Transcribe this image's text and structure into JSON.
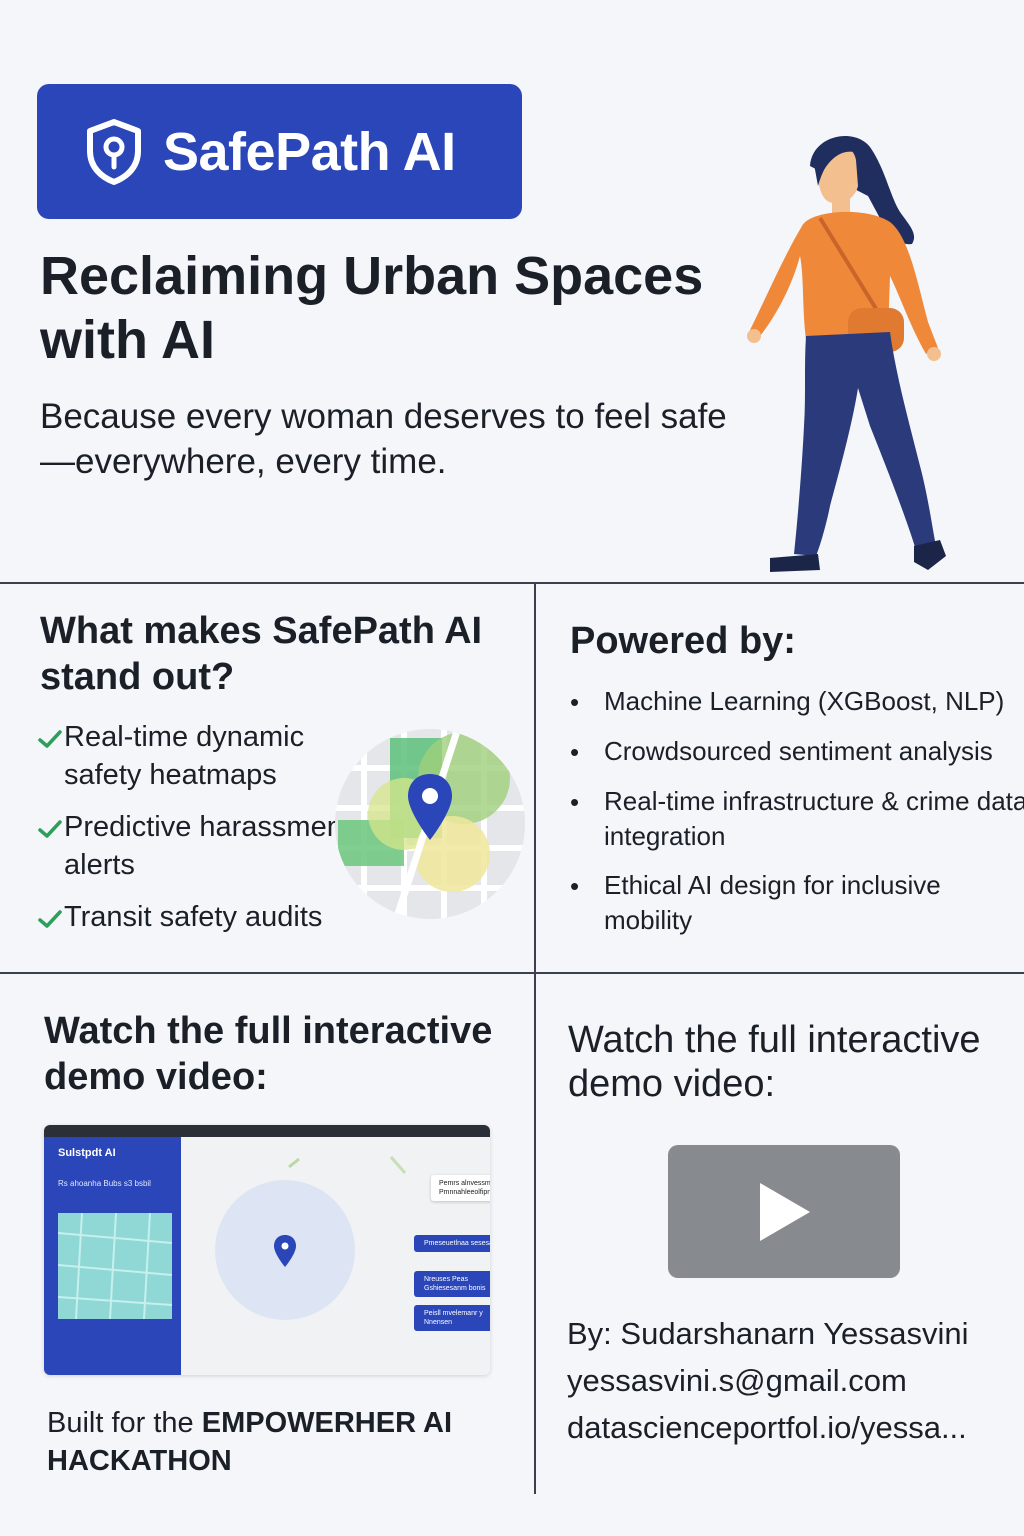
{
  "brand": {
    "name": "SafePath AI",
    "logo_icon": "shield-pin-icon"
  },
  "hero": {
    "title": "Reclaiming Urban Spaces with AI",
    "subtitle": "Because every woman deserves to feel safe—everywhere, every time."
  },
  "features": {
    "title": "What makes SafePath AI stand out?",
    "items": [
      "Real-time dynamic safety heatmaps",
      "Predictive harassment alerts",
      "Transit safety audits"
    ]
  },
  "powered": {
    "title": "Powered by:",
    "items": [
      "Machine Learning (XGBoost, NLP)",
      "Crowdsourced sentiment analysis",
      "Real-time infrastructure & crime data integration",
      "Ethical AI design for inclusive mobility"
    ]
  },
  "demo_left": {
    "title": "Watch the full interactive demo video:",
    "screenshot": {
      "app_title": "Sulstpdt AI",
      "app_subtitle": "Rs ahoanha Bubs s3 bsbil",
      "card_text": "Pemrs alnvessmr Pmnnahleeolfipnrr ne",
      "buttons": [
        "Pmeseuetlnaa sesesaer",
        "Nreuses Peas Gshiesesanm bonis",
        "Peisll mvelemanr y Nnensen"
      ]
    },
    "built_for_prefix": "Built for the ",
    "built_for_event": "EMPOWERHER AI HACKATHON"
  },
  "demo_right": {
    "title": "Watch the full interactive demo video:",
    "author": "By: Sudarshanarn Yessasvini",
    "email": "yessasvini.s@gmail.com",
    "url": "datascienceportfol.io/yessa..."
  },
  "colors": {
    "brand_blue": "#2a46b8",
    "check_green": "#2e9e5b",
    "play_gray": "#878a8f",
    "sweater_orange": "#f0883a",
    "pants_navy": "#2a3a7a"
  }
}
